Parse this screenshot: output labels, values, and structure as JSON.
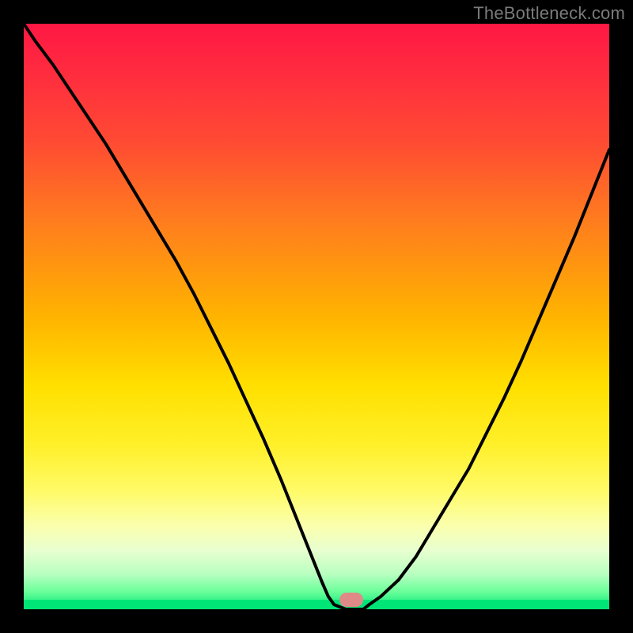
{
  "attribution": "TheBottleneck.com",
  "chart_data": {
    "type": "line",
    "title": "",
    "xlabel": "",
    "ylabel": "",
    "xlim": [
      0,
      100
    ],
    "ylim": [
      0,
      100
    ],
    "x": [
      0,
      2,
      5,
      8,
      11,
      14,
      17,
      20,
      23,
      26,
      29,
      32,
      35,
      38,
      41,
      44,
      47,
      50,
      51,
      52,
      53,
      55,
      56,
      58,
      59,
      61,
      64,
      67,
      70,
      73,
      76,
      79,
      82,
      85,
      88,
      91,
      94,
      97,
      100
    ],
    "values": [
      100,
      97,
      93,
      88.5,
      84,
      79.5,
      74.5,
      69.5,
      64.5,
      59.5,
      54,
      48,
      42,
      35.5,
      29,
      22,
      14.5,
      7,
      4.5,
      2.2,
      0.8,
      0,
      0,
      0,
      0.8,
      2.2,
      5,
      9,
      14,
      19,
      24,
      30,
      36,
      42.5,
      49.5,
      56.5,
      63.5,
      71,
      78.5
    ],
    "marker": {
      "x": 56,
      "y": 0
    },
    "colors": {
      "gradient_top": "#ff1744",
      "gradient_mid": "#ffe000",
      "gradient_bottom": "#00e676",
      "curve": "#000000",
      "marker": "#e08a88",
      "frame": "#000000"
    }
  }
}
